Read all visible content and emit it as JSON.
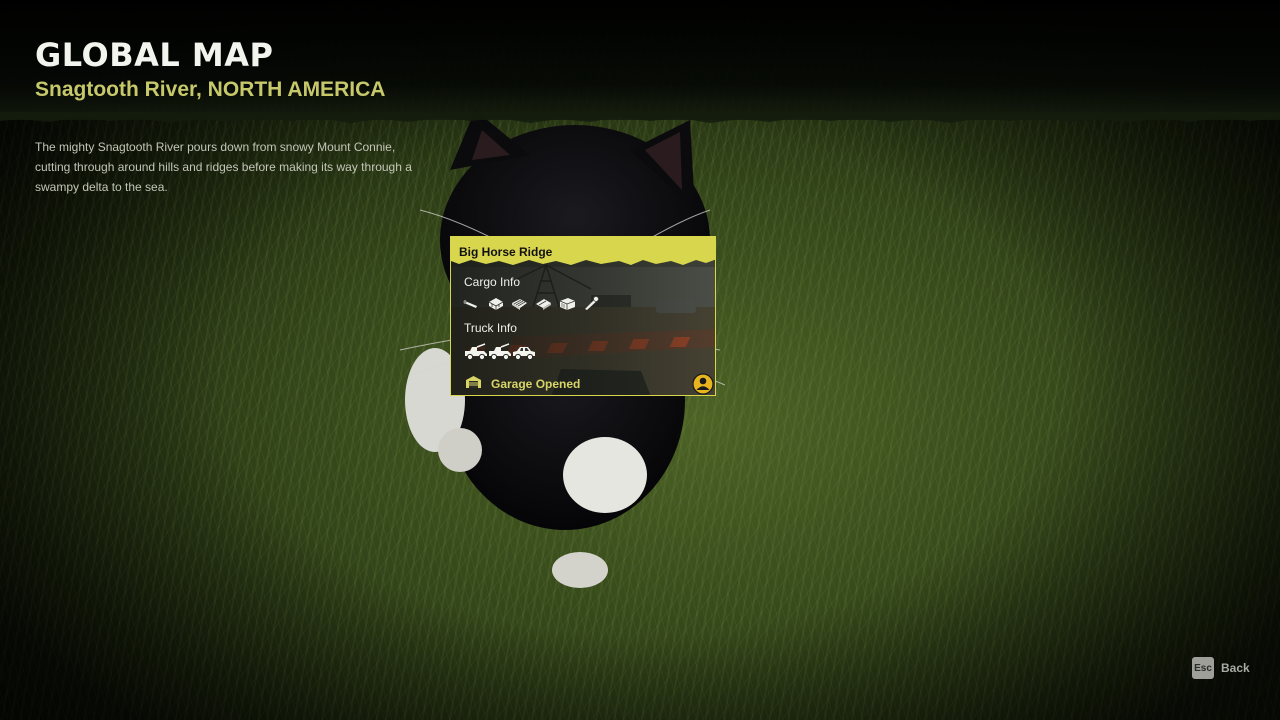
{
  "header": {
    "title": "GLOBAL MAP",
    "subtitle": "Snagtooth River, NORTH AMERICA"
  },
  "description": "The mighty Snagtooth River pours down from snowy Mount Connie, cutting through around hills and ridges before making its way through a swampy delta to the sea.",
  "card": {
    "title": "Big Horse Ridge",
    "cargo_label": "Cargo Info",
    "cargo_icons": [
      "pipe-icon",
      "bricks-icon",
      "wooden-planks-icon",
      "metal-beams-icon",
      "container-icon",
      "special-cargo-icon"
    ],
    "truck_label": "Truck Info",
    "truck_icons": [
      "tow-truck-icon",
      "tow-truck-icon",
      "scout-car-icon"
    ],
    "garage_label": "Garage Opened",
    "accent_color": "#d8d64c"
  },
  "footer": {
    "back_key": "Esc",
    "back_label": "Back"
  }
}
